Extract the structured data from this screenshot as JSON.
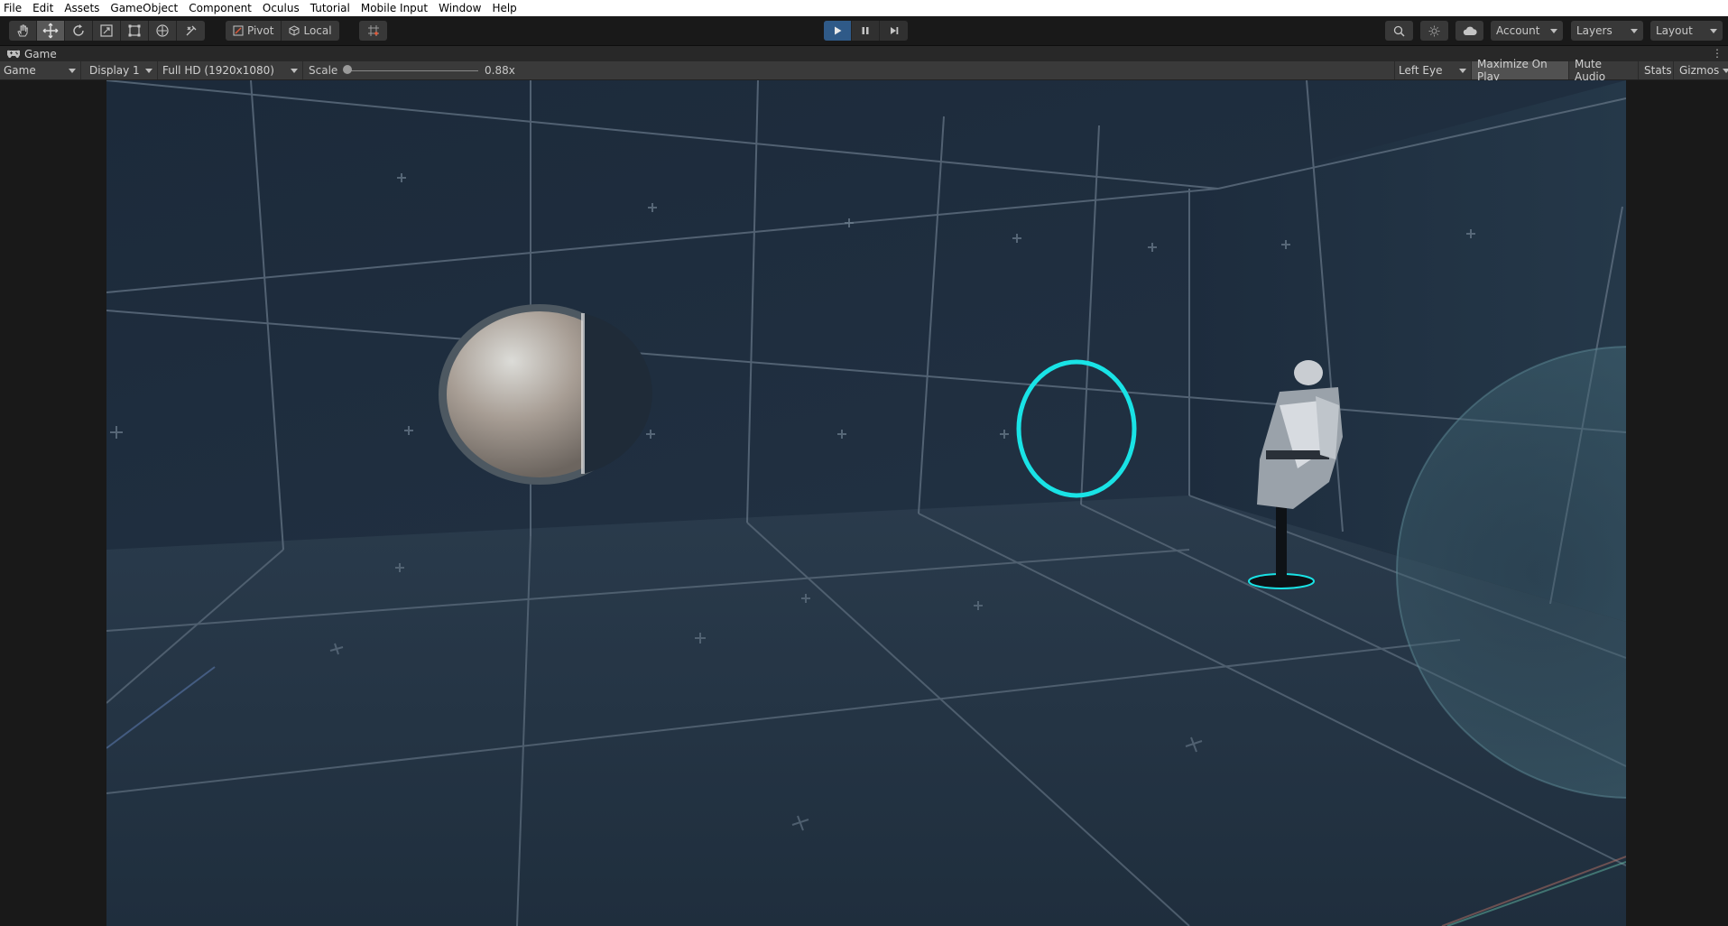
{
  "menu": [
    "File",
    "Edit",
    "Assets",
    "GameObject",
    "Component",
    "Oculus",
    "Tutorial",
    "Mobile Input",
    "Window",
    "Help"
  ],
  "toolbar": {
    "tools": [
      "hand-icon",
      "move-icon",
      "rotate-icon",
      "scale-icon",
      "rect-icon",
      "transform-icon",
      "custom-tool-icon"
    ],
    "active_tool": 1,
    "pivot_label": "Pivot",
    "local_label": "Local",
    "account_label": "Account",
    "layers_label": "Layers",
    "layout_label": "Layout"
  },
  "game_tab": {
    "title": "Game"
  },
  "game_bar": {
    "view": "Game",
    "display": "Display 1",
    "resolution": "Full HD (1920x1080)",
    "scale_label": "Scale",
    "scale_value": "0.88x",
    "eye": "Left Eye",
    "maximize": "Maximize On Play",
    "mute": "Mute Audio",
    "stats": "Stats",
    "gizmos": "Gizmos"
  },
  "colors": {
    "ring": "#19e3e6",
    "play_active": "#2f5a88",
    "scene_bg": "#1d2b3b"
  }
}
